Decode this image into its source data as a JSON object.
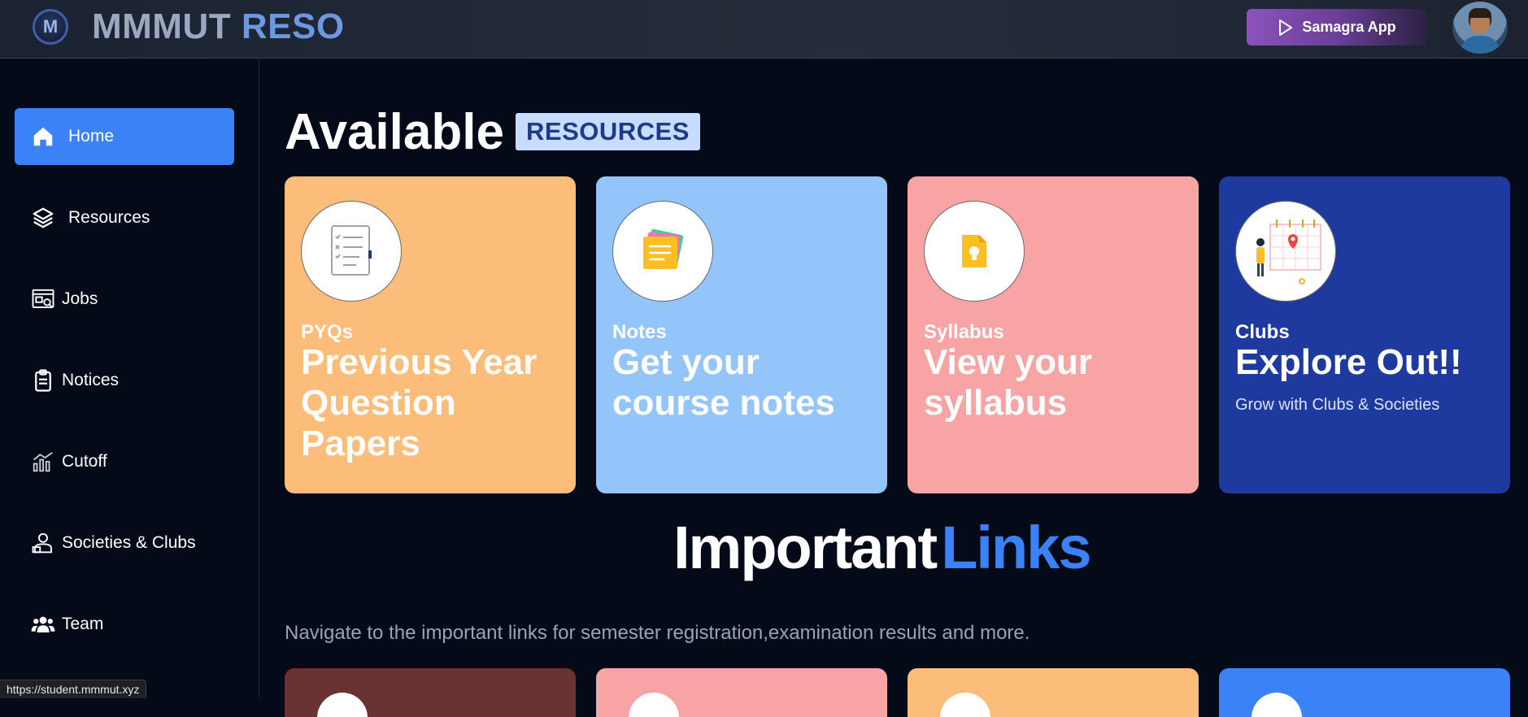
{
  "header": {
    "logo_letter": "M",
    "brand_part1": "MMMUT",
    "brand_part2": "RESO",
    "app_button_label": "Samagra App",
    "app_button_icon": "play-icon"
  },
  "sidebar": {
    "items": [
      {
        "label": "Home",
        "icon": "home-icon",
        "active": true
      },
      {
        "label": "Resources",
        "icon": "layers-icon",
        "active": false
      },
      {
        "label": "Jobs",
        "icon": "jobs-icon",
        "active": false
      },
      {
        "label": "Notices",
        "icon": "clipboard-icon",
        "active": false
      },
      {
        "label": "Cutoff",
        "icon": "bar-chart-icon",
        "active": false
      },
      {
        "label": "Societies & Clubs",
        "icon": "people-badge-icon",
        "active": false
      },
      {
        "label": "Team",
        "icon": "team-icon",
        "active": false
      }
    ]
  },
  "main": {
    "title_word": "Available",
    "title_tag": "RESOURCES",
    "cards": [
      {
        "kicker": "PYQs",
        "headline": "Previous Year Question Papers",
        "sub": "",
        "color": "#fcbc7a",
        "icon": "question-paper-icon"
      },
      {
        "kicker": "Notes",
        "headline": "Get your course notes",
        "sub": "",
        "color": "#93c4fa",
        "icon": "sticky-notes-icon"
      },
      {
        "kicker": "Syllabus",
        "headline": "View your syllabus",
        "sub": "",
        "color": "#f9a4a4",
        "icon": "document-idea-icon"
      },
      {
        "kicker": "Clubs",
        "headline": "Explore Out!!",
        "sub": "Grow with Clubs & Societies",
        "color": "#1e3a9f",
        "icon": "calendar-person-icon"
      }
    ],
    "links_title_part1": "Important",
    "links_title_part2": "Links",
    "links_description": "Navigate to the important links for semester registration,examination results and more.",
    "link_card_colors": [
      "#6b3232",
      "#f9a4a4",
      "#fcbc7a",
      "#3b82f6"
    ]
  },
  "status_bar": {
    "url": "https://student.mmmut.xyz"
  },
  "colors": {
    "background": "#050a19",
    "accent": "#3b82f6",
    "tag_bg": "#c7dcff"
  }
}
